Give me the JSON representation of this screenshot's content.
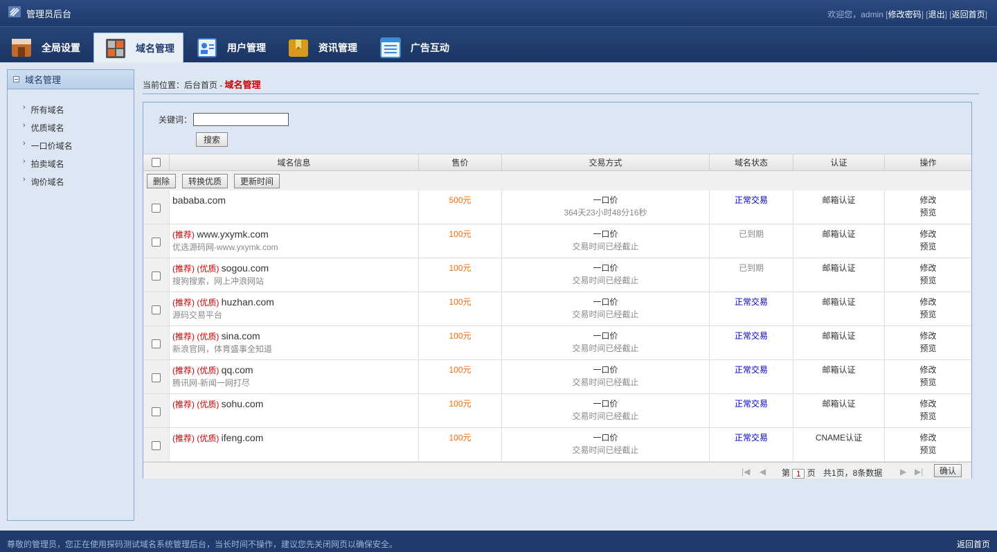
{
  "app": {
    "title": "管理员后台"
  },
  "user_links": {
    "welcome": "欢迎您，admin",
    "change_password": "修改密码",
    "logout": "退出",
    "home": "返回首页"
  },
  "tabs": [
    {
      "label": "全局设置",
      "icon": "settings-icon",
      "color": "#b8612a"
    },
    {
      "label": "域名管理",
      "icon": "domain-grid-icon",
      "color": "#555"
    },
    {
      "label": "用户管理",
      "icon": "user-card-icon",
      "color": "#3b7bd6"
    },
    {
      "label": "资讯管理",
      "icon": "news-box-icon",
      "color": "#d89a1d"
    },
    {
      "label": "广告互动",
      "icon": "ad-list-icon",
      "color": "#3b8bd6"
    }
  ],
  "sidebar": {
    "title": "域名管理",
    "items": [
      "所有域名",
      "优质域名",
      "一口价域名",
      "拍卖域名",
      "询价域名"
    ]
  },
  "breadcrumb": {
    "prefix": "当前位置：后台首页 - ",
    "current": "域名管理"
  },
  "search": {
    "label": "关键词：",
    "value": "",
    "button": "搜索"
  },
  "table": {
    "headers": [
      "域名信息",
      "售价",
      "交易方式",
      "域名状态",
      "认证",
      "操作"
    ],
    "toolbar": [
      "删除",
      "转换优质",
      "更新时间"
    ],
    "rows": [
      {
        "tags": "",
        "domain": "bababa.com",
        "desc": "",
        "price": "500元",
        "mode": "一口价",
        "time": "364天23小时48分16秒",
        "status": "正常交易",
        "status_ok": true,
        "auth": "邮箱认证",
        "op1": "修改",
        "op2": "预览"
      },
      {
        "tags": "(推荐)",
        "domain": "www.yxymk.com",
        "desc": "优选源码网-www.yxymk.com",
        "price": "100元",
        "mode": "一口价",
        "time": "交易时间已经截止",
        "status": "已到期",
        "status_ok": false,
        "auth": "邮箱认证",
        "op1": "修改",
        "op2": "预览"
      },
      {
        "tags": "(推荐) (优质)",
        "domain": "sogou.com",
        "desc": "搜狗搜索，网上冲浪网站",
        "price": "100元",
        "mode": "一口价",
        "time": "交易时间已经截止",
        "status": "已到期",
        "status_ok": false,
        "auth": "邮箱认证",
        "op1": "修改",
        "op2": "预览"
      },
      {
        "tags": "(推荐) (优质)",
        "domain": "huzhan.com",
        "desc": "源码交易平台",
        "price": "100元",
        "mode": "一口价",
        "time": "交易时间已经截止",
        "status": "正常交易",
        "status_ok": true,
        "auth": "邮箱认证",
        "op1": "修改",
        "op2": "预览"
      },
      {
        "tags": "(推荐) (优质)",
        "domain": "sina.com",
        "desc": "新浪官网，体育盛事全知道",
        "price": "100元",
        "mode": "一口价",
        "time": "交易时间已经截止",
        "status": "正常交易",
        "status_ok": true,
        "auth": "邮箱认证",
        "op1": "修改",
        "op2": "预览"
      },
      {
        "tags": "(推荐) (优质)",
        "domain": "qq.com",
        "desc": "腾讯网-新闻一网打尽",
        "price": "100元",
        "mode": "一口价",
        "time": "交易时间已经截止",
        "status": "正常交易",
        "status_ok": true,
        "auth": "邮箱认证",
        "op1": "修改",
        "op2": "预览"
      },
      {
        "tags": "(推荐) (优质)",
        "domain": "sohu.com",
        "desc": "",
        "price": "100元",
        "mode": "一口价",
        "time": "交易时间已经截止",
        "status": "正常交易",
        "status_ok": true,
        "auth": "邮箱认证",
        "op1": "修改",
        "op2": "预览"
      },
      {
        "tags": "(推荐) (优质)",
        "domain": "ifeng.com",
        "desc": "",
        "price": "100元",
        "mode": "一口价",
        "time": "交易时间已经截止",
        "status": "正常交易",
        "status_ok": true,
        "auth": "CNAME认证",
        "op1": "修改",
        "op2": "预览"
      }
    ]
  },
  "pager": {
    "page_prefix": "第",
    "page": "1",
    "page_suffix": "页",
    "summary": "共1页，8条数据",
    "confirm": "确认"
  },
  "footer": {
    "notice": "尊敬的管理员，您正在使用探码测试域名系统管理后台，当长时间不操作，建议您先关闭网页以确保安全。",
    "back": "返回首页"
  }
}
